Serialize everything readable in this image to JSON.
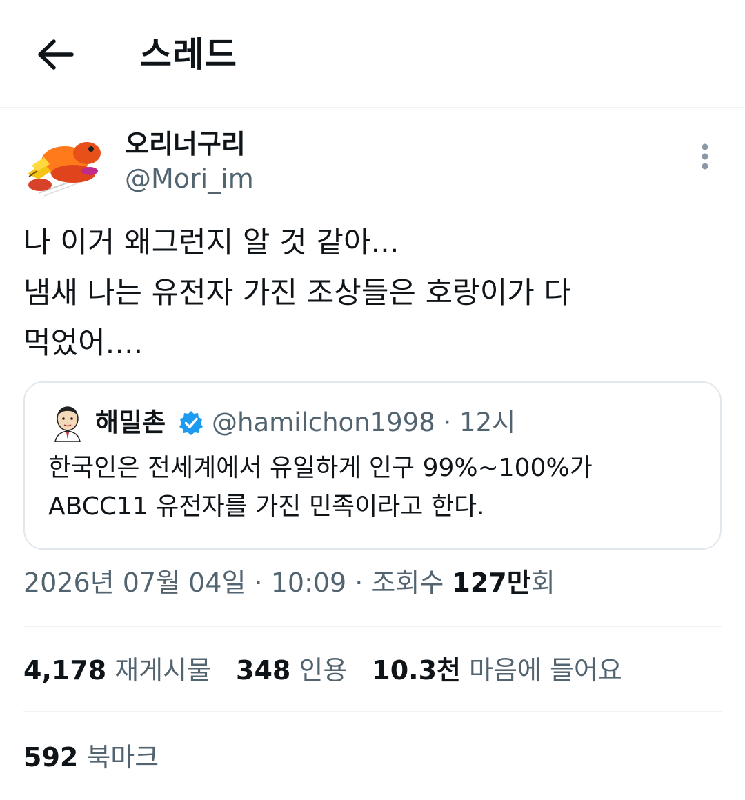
{
  "header": {
    "back_icon": "arrow-left-icon",
    "title": "스레드"
  },
  "author": {
    "display_name": "오리너구리",
    "handle": "@Mori_im",
    "avatar_icon": "duck-cartoon-avatar",
    "more_icon": "more-vertical-icon"
  },
  "tweet": {
    "lines": [
      "나 이거 왜그런지 알 것 같아...",
      "냄새 나는 유전자 가진 조상들은 호랑이가 다",
      "먹었어...."
    ]
  },
  "quote": {
    "display_name": "해밀촌",
    "verified_icon": "verified-badge-icon",
    "handle_time": "@hamilchon1998 · 12시",
    "lines": [
      "한국인은 전세계에서 유일하게 인구 99%~100%가",
      "ABCC11 유전자를 가진 민족이라고 한다."
    ]
  },
  "meta": {
    "date_time": "2026년 07월 04일 · 10:09 · 조회수 ",
    "views_count": "127만",
    "views_suffix": "회"
  },
  "stats": {
    "reposts": {
      "count": "4,178",
      "label": "재게시물"
    },
    "quotes": {
      "count": "348",
      "label": "인용"
    },
    "likes": {
      "count": "10.3천",
      "label": "마음에 들어요"
    },
    "bookmarks": {
      "count": "592",
      "label": "북마크"
    }
  },
  "colors": {
    "text": "#0f1419",
    "secondary": "#536471",
    "border": "#eff3f4",
    "verified": "#1d9bf0"
  }
}
